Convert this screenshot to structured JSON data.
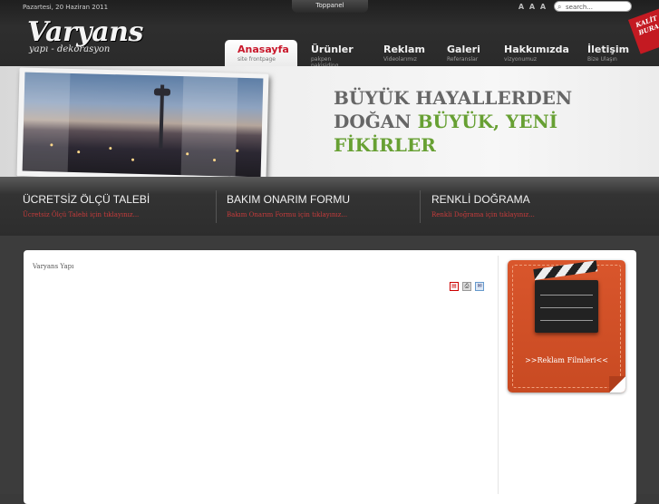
{
  "topbar": {
    "date": "Pazartesi, 20 Haziran 2011",
    "toppanel": "Toppanel",
    "font_sizes": [
      "A",
      "A",
      "A"
    ],
    "search_placeholder": "search..."
  },
  "logo": {
    "main": "Varyans",
    "sub": "yapı - dekorasyon"
  },
  "nav": [
    {
      "label": "Anasayfa",
      "sub": "site frontpage",
      "active": true
    },
    {
      "label": "Ürünler",
      "sub": "pakpen pakisiding"
    },
    {
      "label": "Reklam",
      "sub": "Videolarımız"
    },
    {
      "label": "Galeri",
      "sub": "Referanslar"
    },
    {
      "label": "Hakkımızda",
      "sub": "vizyonumuz"
    },
    {
      "label": "İletişim",
      "sub": "Bize Ulaşın"
    }
  ],
  "ribbon": {
    "line1": "KALİT",
    "line2": "BURA"
  },
  "banner": {
    "line1": "BÜYÜK HAYALLERDEN",
    "line2a": "DOĞAN",
    "line2b": "BÜYÜK, YENİ",
    "line3": "FİKİRLER"
  },
  "features": [
    {
      "title": "ÜCRETSİZ ÖLÇÜ TALEBİ",
      "desc": "Ücretsiz Ölçü Talebi için tıklayınız..."
    },
    {
      "title": "BAKIM ONARIM FORMU",
      "desc": "Bakım Onarım Formu için tıklayınız..."
    },
    {
      "title": "RENKLİ DOĞRAMA",
      "desc": "Renkli Doğrama için tıklayınız..."
    }
  ],
  "content": {
    "breadcrumb": "Varyans Yapı"
  },
  "sidebar": {
    "ad_label": ">>Reklam Filmleri<<"
  },
  "colors": {
    "accent_red": "#c9182b",
    "banner_green": "#67a033",
    "ad_orange": "#d9562c"
  }
}
